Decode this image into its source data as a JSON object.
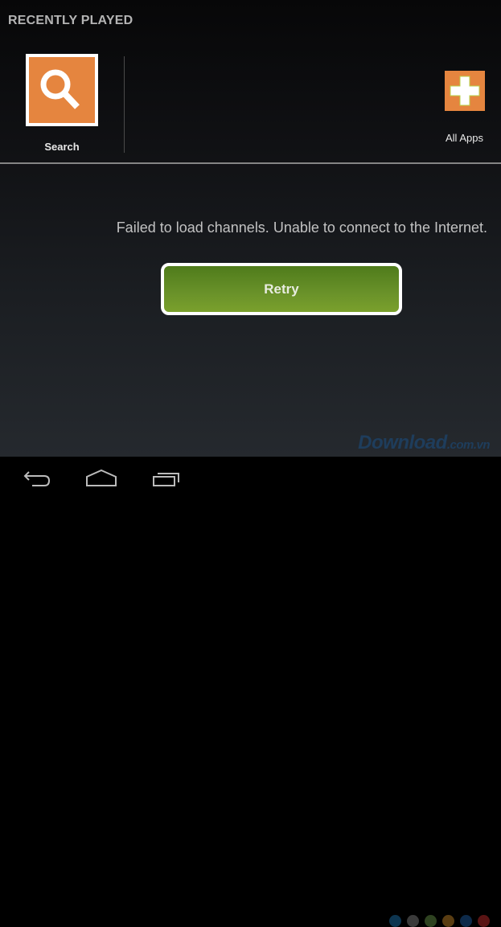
{
  "section": {
    "title": "RECENTLY PLAYED"
  },
  "tiles": [
    {
      "label": "Search",
      "icon": "search-icon"
    },
    {
      "label": "All Apps",
      "icon": "plus-icon"
    }
  ],
  "error": {
    "message": "Failed to load channels. Unable to connect to the Internet."
  },
  "retry": {
    "label": "Retry"
  },
  "watermark": {
    "main": "Download",
    "suffix": ".com.vn",
    "dot_colors": [
      "#0d3550",
      "#3a3a3a",
      "#2e4220",
      "#5a3d12",
      "#0d2a4a",
      "#5a1414"
    ]
  },
  "navbar": {
    "buttons": [
      "back",
      "home",
      "recent-apps"
    ]
  },
  "colors": {
    "tile_orange": "#e5853f",
    "retry_green": "#6a922a"
  }
}
